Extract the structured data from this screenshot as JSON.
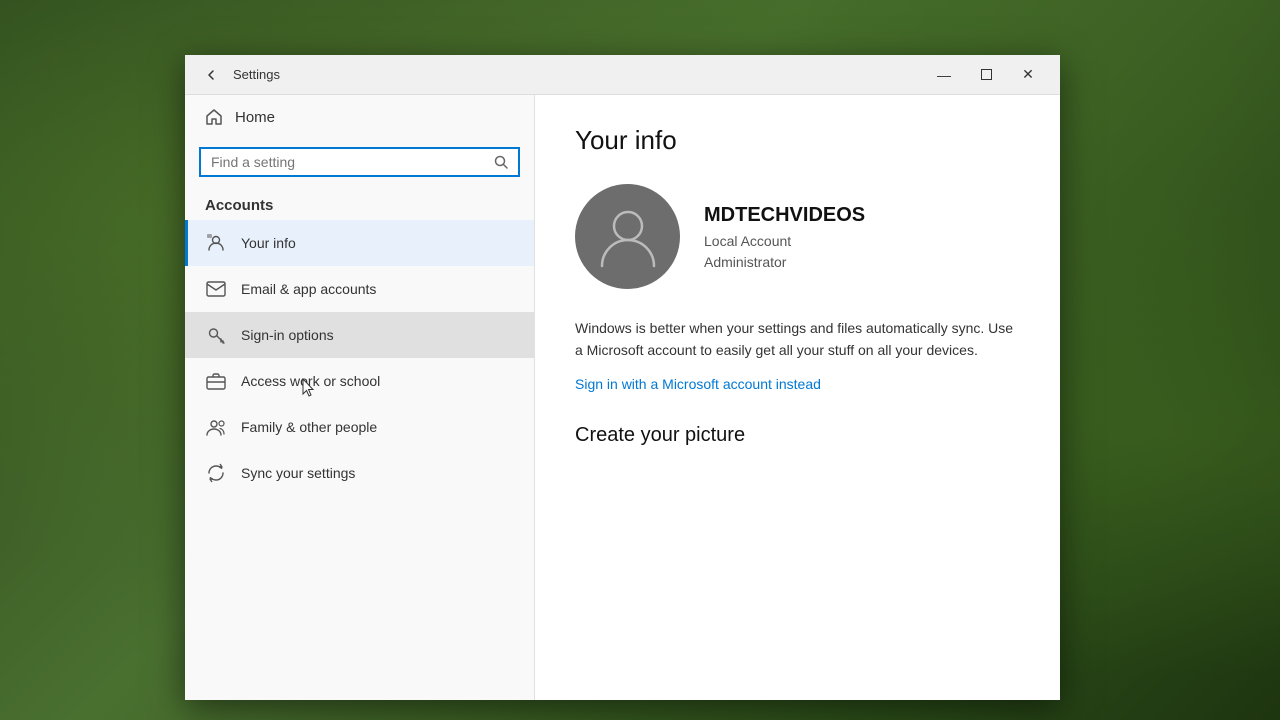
{
  "desktop": {
    "bg_description": "Forest mossy background"
  },
  "window": {
    "title": "Settings",
    "title_bar": {
      "back_label": "←",
      "minimize_label": "—",
      "restore_label": "❐",
      "close_label": "✕"
    }
  },
  "sidebar": {
    "home_label": "Home",
    "search_placeholder": "Find a setting",
    "section_label": "Accounts",
    "nav_items": [
      {
        "id": "your-info",
        "label": "Your info",
        "icon": "person-icon",
        "active": true
      },
      {
        "id": "email-app-accounts",
        "label": "Email & app accounts",
        "icon": "email-icon",
        "active": false
      },
      {
        "id": "sign-in-options",
        "label": "Sign-in options",
        "icon": "key-icon",
        "active": false,
        "hovered": true
      },
      {
        "id": "access-work-school",
        "label": "Access work or school",
        "icon": "briefcase-icon",
        "active": false
      },
      {
        "id": "family-other-people",
        "label": "Family & other people",
        "icon": "people-icon",
        "active": false
      },
      {
        "id": "sync-settings",
        "label": "Sync your settings",
        "icon": "sync-icon",
        "active": false
      }
    ]
  },
  "content": {
    "page_title": "Your info",
    "profile": {
      "username": "MDTECHVIDEOS",
      "account_type_line1": "Local Account",
      "account_type_line2": "Administrator"
    },
    "sync_message": "Windows is better when your settings and files automatically sync. Use a Microsoft account to easily get all your stuff on all your devices.",
    "microsoft_link": "Sign in with a Microsoft account instead",
    "create_picture_title": "Create your picture"
  }
}
